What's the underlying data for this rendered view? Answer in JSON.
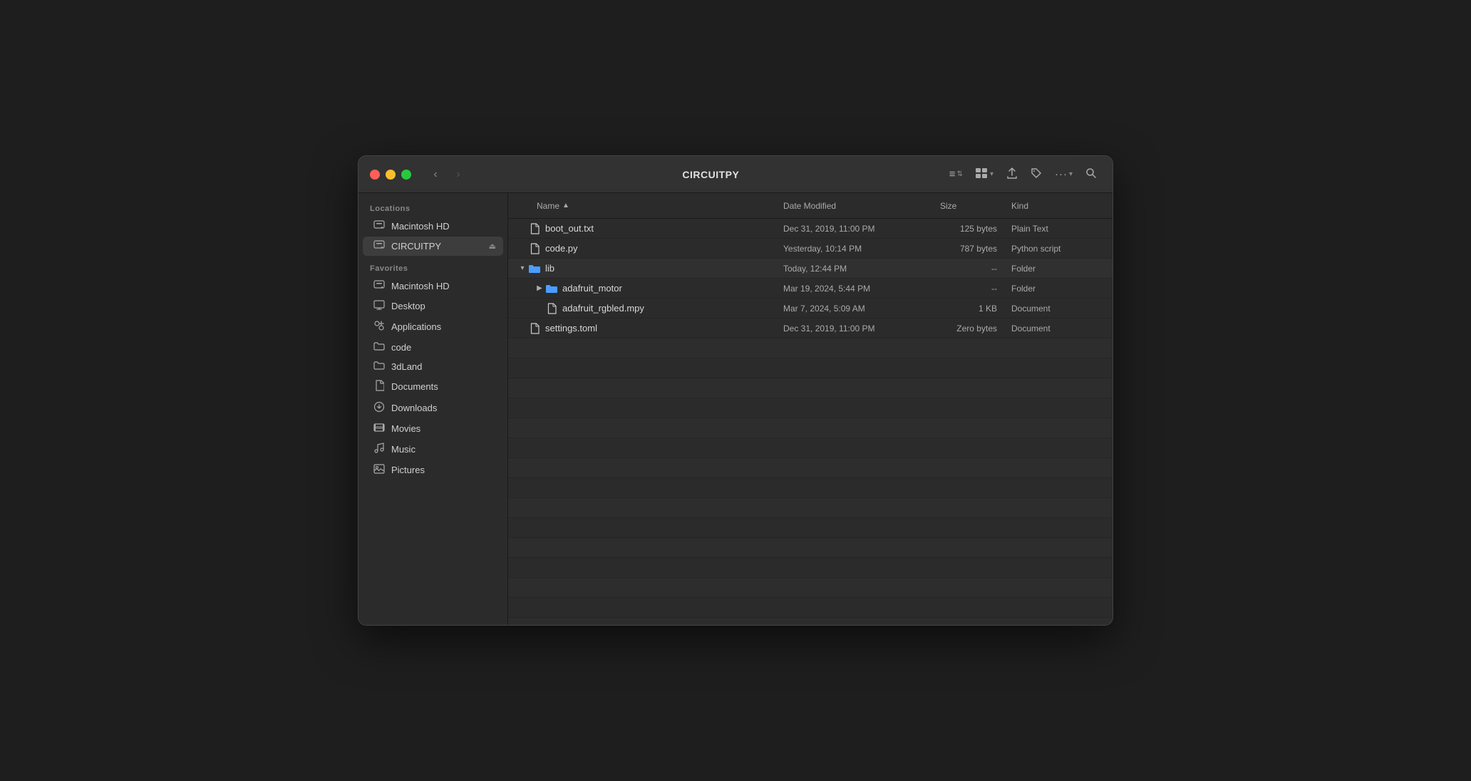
{
  "window": {
    "title": "CIRCUITPY"
  },
  "titlebar": {
    "back_label": "‹",
    "forward_label": "›",
    "list_view_icon": "≡",
    "grid_view_icon": "⊞",
    "share_icon": "↑",
    "tag_icon": "◇",
    "more_icon": "•••",
    "search_icon": "⌕"
  },
  "sidebar": {
    "locations_label": "Locations",
    "favorites_label": "Favorites",
    "locations": [
      {
        "id": "macintosh-hd",
        "label": "Macintosh HD",
        "icon": "drive"
      },
      {
        "id": "circuitpy",
        "label": "CIRCUITPY",
        "icon": "drive",
        "active": true,
        "eject": true
      }
    ],
    "favorites": [
      {
        "id": "macintosh-hd-fav",
        "label": "Macintosh HD",
        "icon": "drive"
      },
      {
        "id": "desktop",
        "label": "Desktop",
        "icon": "desktop"
      },
      {
        "id": "applications",
        "label": "Applications",
        "icon": "applications"
      },
      {
        "id": "code",
        "label": "code",
        "icon": "folder"
      },
      {
        "id": "3dland",
        "label": "3dLand",
        "icon": "folder"
      },
      {
        "id": "documents",
        "label": "Documents",
        "icon": "doc"
      },
      {
        "id": "downloads",
        "label": "Downloads",
        "icon": "downloads"
      },
      {
        "id": "movies",
        "label": "Movies",
        "icon": "movies"
      },
      {
        "id": "music",
        "label": "Music",
        "icon": "music"
      },
      {
        "id": "pictures",
        "label": "Pictures",
        "icon": "pictures"
      }
    ]
  },
  "columns": {
    "name": "Name",
    "date_modified": "Date Modified",
    "size": "Size",
    "kind": "Kind"
  },
  "files": [
    {
      "id": "boot_out",
      "name": "boot_out.txt",
      "type": "file",
      "date": "Dec 31, 2019, 11:00 PM",
      "size": "125 bytes",
      "kind": "Plain Text",
      "indent": 0
    },
    {
      "id": "code_py",
      "name": "code.py",
      "type": "file",
      "date": "Yesterday, 10:14 PM",
      "size": "787 bytes",
      "kind": "Python script",
      "indent": 0
    },
    {
      "id": "lib",
      "name": "lib",
      "type": "folder",
      "expanded": true,
      "date": "Today, 12:44 PM",
      "size": "--",
      "kind": "Folder",
      "indent": 0
    },
    {
      "id": "adafruit_motor",
      "name": "adafruit_motor",
      "type": "folder",
      "expanded": false,
      "date": "Mar 19, 2024, 5:44 PM",
      "size": "--",
      "kind": "Folder",
      "indent": 1
    },
    {
      "id": "adafruit_rgbled",
      "name": "adafruit_rgbled.mpy",
      "type": "file",
      "date": "Mar 7, 2024, 5:09 AM",
      "size": "1 KB",
      "kind": "Document",
      "indent": 1
    },
    {
      "id": "settings_toml",
      "name": "settings.toml",
      "type": "file",
      "date": "Dec 31, 2019, 11:00 PM",
      "size": "Zero bytes",
      "kind": "Document",
      "indent": 0
    }
  ]
}
